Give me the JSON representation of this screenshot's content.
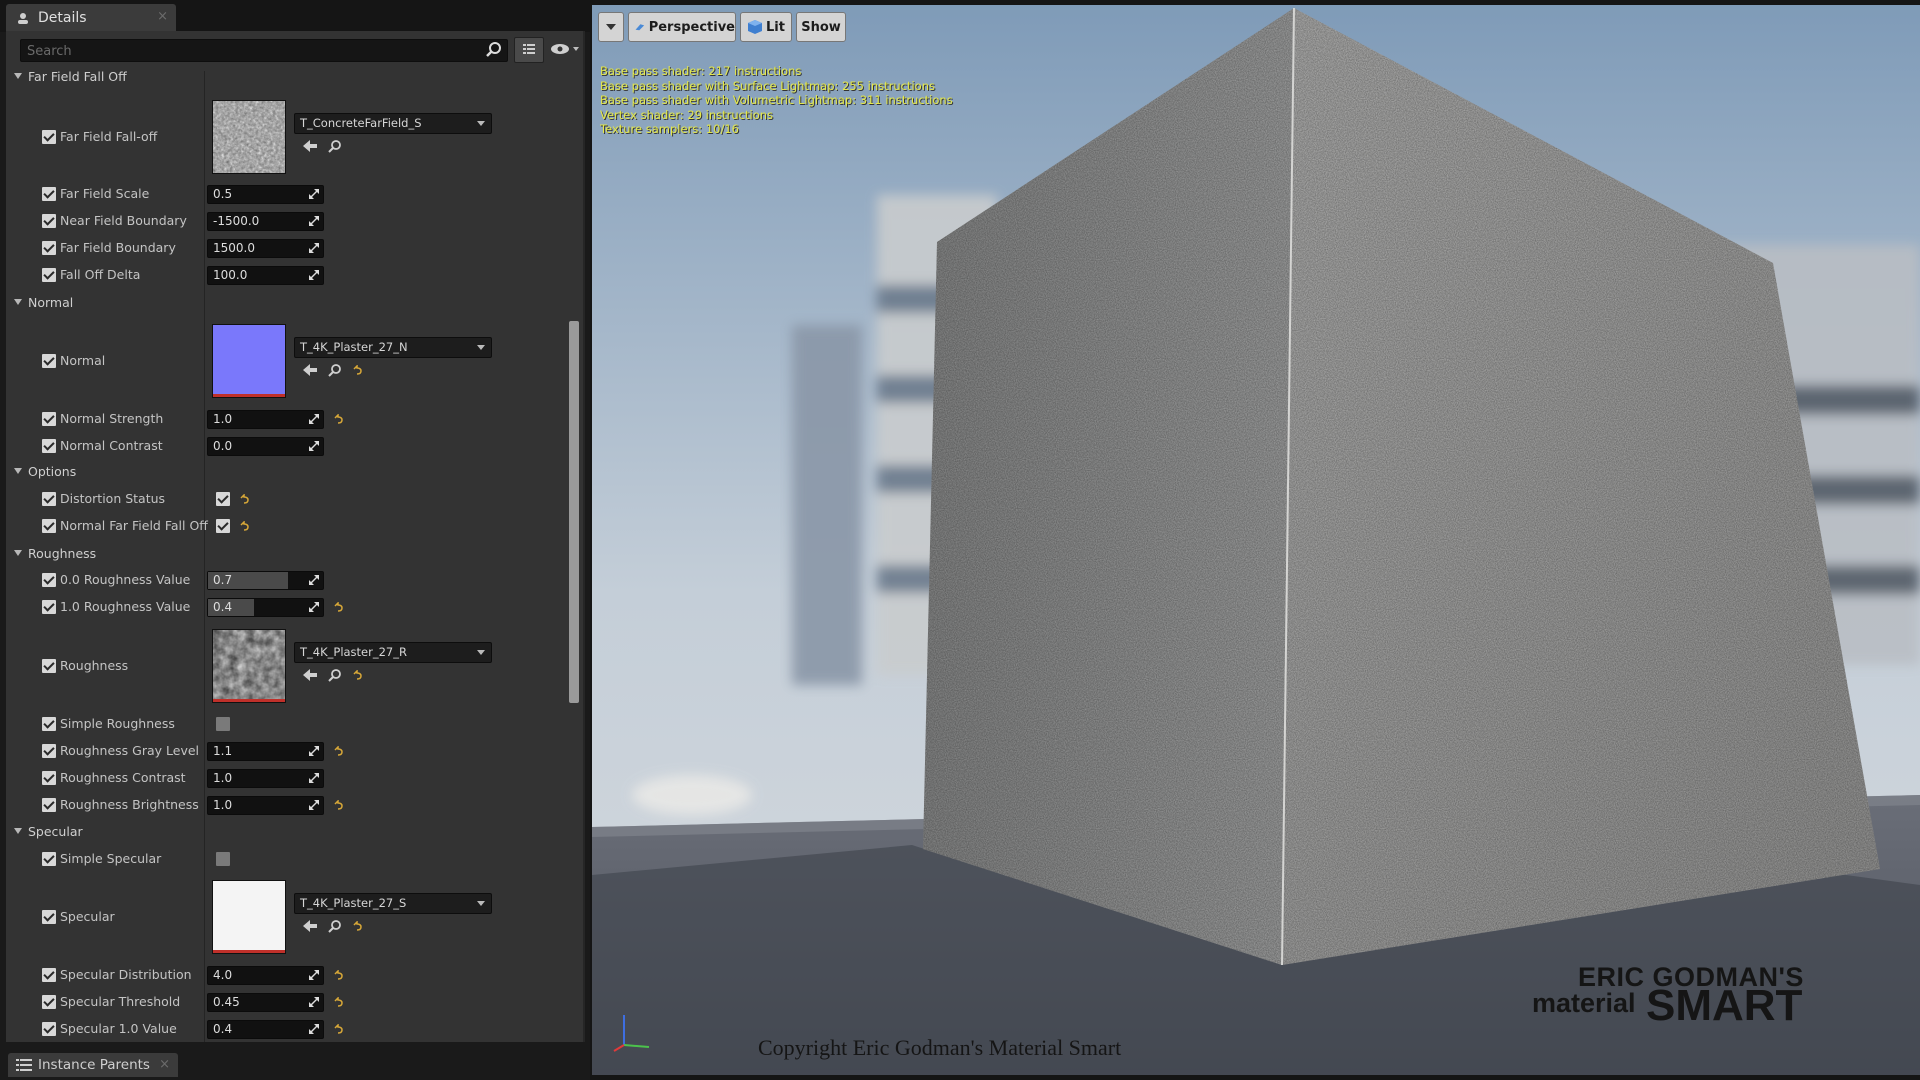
{
  "details_tab": {
    "title": "Details",
    "close": "×"
  },
  "search": {
    "placeholder": "Search"
  },
  "categories": {
    "far_field": "Far Field Fall Off",
    "normal": "Normal",
    "options": "Options",
    "roughness": "Roughness",
    "specular": "Specular"
  },
  "params": {
    "far_field_falloff": {
      "label": "Far Field Fall-off",
      "texture": "T_ConcreteFarField_S"
    },
    "far_field_scale": {
      "label": "Far Field Scale",
      "value": "0.5"
    },
    "near_field_boundary": {
      "label": "Near Field Boundary",
      "value": "-1500.0"
    },
    "far_field_boundary": {
      "label": "Far Field Boundary",
      "value": "1500.0"
    },
    "fall_off_delta": {
      "label": "Fall Off Delta",
      "value": "100.0"
    },
    "normal": {
      "label": "Normal",
      "texture": "T_4K_Plaster_27_N"
    },
    "normal_strength": {
      "label": "Normal Strength",
      "value": "1.0"
    },
    "normal_contrast": {
      "label": "Normal Contrast",
      "value": "0.0"
    },
    "distortion_status": {
      "label": "Distortion Status"
    },
    "normal_far_field_fall_off": {
      "label": "Normal Far Field Fall Off"
    },
    "roughness_value_00": {
      "label": "0.0 Roughness Value",
      "value": "0.7"
    },
    "roughness_value_10": {
      "label": "1.0 Roughness Value",
      "value": "0.4"
    },
    "roughness": {
      "label": "Roughness",
      "texture": "T_4K_Plaster_27_R"
    },
    "simple_roughness": {
      "label": "Simple Roughness"
    },
    "roughness_gray_level": {
      "label": "Roughness Gray Level",
      "value": "1.1"
    },
    "roughness_contrast": {
      "label": "Roughness Contrast",
      "value": "1.0"
    },
    "roughness_brightness": {
      "label": "Roughness Brightness",
      "value": "1.0"
    },
    "simple_specular": {
      "label": "Simple Specular"
    },
    "specular": {
      "label": "Specular",
      "texture": "T_4K_Plaster_27_S"
    },
    "specular_distribution": {
      "label": "Specular Distribution",
      "value": "4.0"
    },
    "specular_threshold": {
      "label": "Specular Threshold",
      "value": "0.45"
    },
    "specular_10_value": {
      "label": "Specular 1.0 Value",
      "value": "0.4"
    }
  },
  "bottom_tab": {
    "title": "Instance Parents",
    "close": "×"
  },
  "viewport": {
    "perspective": "Perspective",
    "lit": "Lit",
    "show": "Show",
    "stats": [
      "Base pass shader: 217 instructions",
      "Base pass shader with Surface Lightmap: 255 instructions",
      "Base pass shader with Volumetric Lightmap: 311 instructions",
      "Vertex shader: 29 instructions",
      "Texture samplers: 10/16"
    ],
    "brand_line1": "ERIC GODMAN'S",
    "brand_line2": "material",
    "brand_line3": "SMART",
    "copyright": "Copyright Eric Godman's Material Smart"
  },
  "colors": {
    "panel_bg": "#333333",
    "field_bg": "#111111",
    "normal_map": "#7f7fff",
    "stats_text": "#e4e84a",
    "reset_arrow": "#d8a838"
  }
}
